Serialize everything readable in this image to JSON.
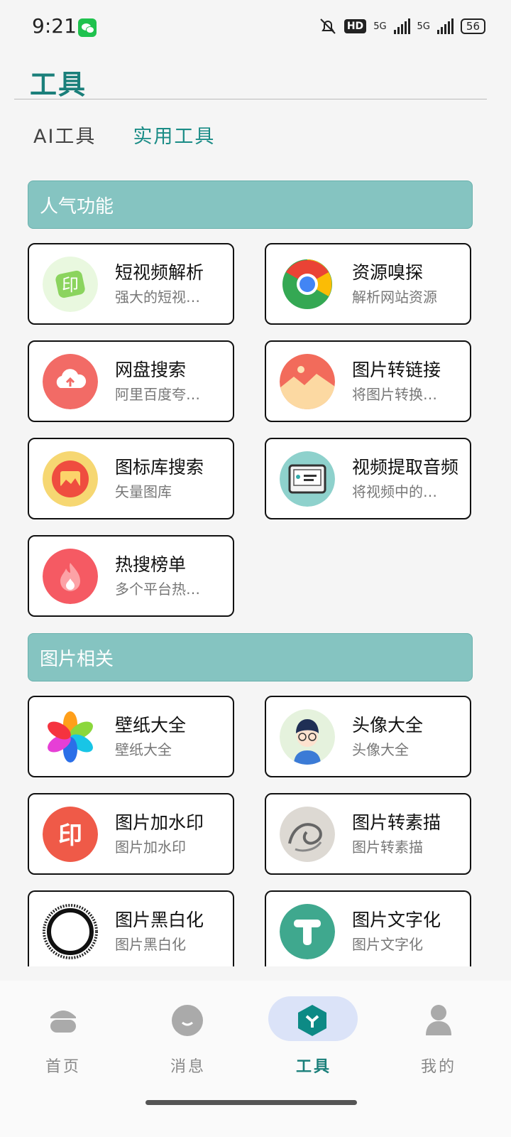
{
  "status_bar": {
    "time": "9:21",
    "hd_label": "HD",
    "net1": "5G",
    "net2": "5G",
    "battery": "56"
  },
  "header": {
    "title": "工具"
  },
  "tabs": [
    {
      "label": "AI工具",
      "active": false
    },
    {
      "label": "实用工具",
      "active": true
    }
  ],
  "sections": [
    {
      "title": "人气功能",
      "items": [
        {
          "title": "短视频解析",
          "subtitle": "强大的短视…",
          "icon": "video-parse-icon"
        },
        {
          "title": "资源嗅探",
          "subtitle": "解析网站资源",
          "icon": "chrome-icon"
        },
        {
          "title": "网盘搜索",
          "subtitle": "阿里百度夸…",
          "icon": "cloud-upload-icon"
        },
        {
          "title": "图片转链接",
          "subtitle": "将图片转换…",
          "icon": "image-link-icon"
        },
        {
          "title": "图标库搜索",
          "subtitle": "矢量图库",
          "icon": "icon-library-icon"
        },
        {
          "title": "视频提取音频",
          "subtitle": "将视频中的…",
          "icon": "video-audio-icon"
        },
        {
          "title": "热搜榜单",
          "subtitle": "多个平台热…",
          "icon": "fire-icon"
        }
      ]
    },
    {
      "title": "图片相关",
      "items": [
        {
          "title": "壁纸大全",
          "subtitle": "壁纸大全",
          "icon": "wallpaper-icon"
        },
        {
          "title": "头像大全",
          "subtitle": "头像大全",
          "icon": "avatar-icon"
        },
        {
          "title": "图片加水印",
          "subtitle": "图片加水印",
          "icon": "watermark-icon"
        },
        {
          "title": "图片转素描",
          "subtitle": "图片转素描",
          "icon": "sketch-icon"
        },
        {
          "title": "图片黑白化",
          "subtitle": "图片黑白化",
          "icon": "grayscale-icon"
        },
        {
          "title": "图片文字化",
          "subtitle": "图片文字化",
          "icon": "text-image-icon"
        }
      ]
    }
  ],
  "bottom_nav": [
    {
      "label": "首页",
      "icon": "home-icon",
      "active": false
    },
    {
      "label": "消息",
      "icon": "message-icon",
      "active": false
    },
    {
      "label": "工具",
      "icon": "tools-icon",
      "active": true
    },
    {
      "label": "我的",
      "icon": "profile-icon",
      "active": false
    }
  ],
  "colors": {
    "accent": "#1a7f7a",
    "section_bg": "#85c4c1",
    "nav_pill": "#dbe3f8"
  }
}
